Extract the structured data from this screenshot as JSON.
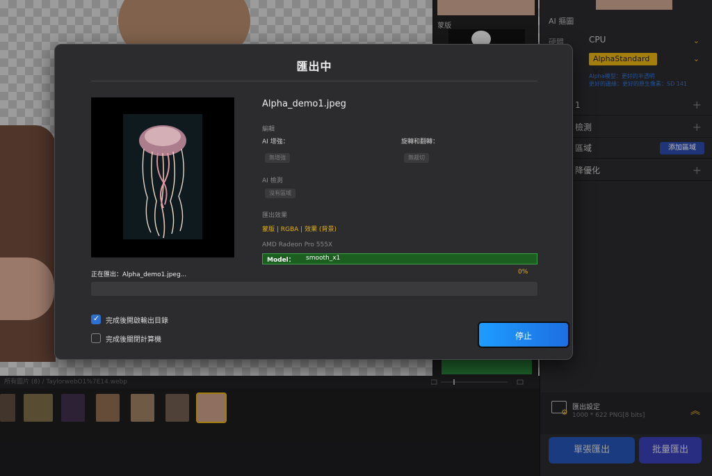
{
  "modal": {
    "title": "匯出中",
    "file_name": "Alpha_demo1.jpeg",
    "edit_section": "編輯",
    "ai_enhance_label": "AI 增強：",
    "ai_enhance_value": "無增強",
    "rotate_label": "旋轉和翻轉：",
    "rotate_value": "無裁切",
    "ai_detect_section": "AI 檢測",
    "ai_detect_value": "沒有區域",
    "export_effect_section": "匯出效果",
    "export_effect_value": "蒙版 | RGBA | 效果 (背景)",
    "gpu_name": "AMD Radeon Pro 555X",
    "model_label": "Model：",
    "model_value": "smooth_x1",
    "progress_percent_text": "0%",
    "progress_fraction": 0,
    "exporting_text": "正在匯出：Alpha_demo1.jpeg...",
    "open_dir_label": "完成後開啟輸出目錄",
    "open_dir_checked": true,
    "shutdown_label": "完成後關閉計算機",
    "shutdown_checked": false,
    "stop_button": "停止"
  },
  "right_panel": {
    "ai_header": "AI 摳圖",
    "hardware_label": "硬體",
    "hardware_value": "CPU",
    "model_value": "AlphaStandard V2",
    "note_line1": "Alpha模型：更好的半透明",
    "note_line2": "更好的邊緣：更好的原生像素：SD 141",
    "row1_label": "1",
    "row2_label": "檢測",
    "row3_label": "區域",
    "add_area_button": "添加區域",
    "row4_label": "降優化",
    "export_settings_title": "匯出設定",
    "export_settings_info": "1000 * 622 PNG[8 bits]",
    "single_export": "單張匯出",
    "batch_export": "批量匯出"
  },
  "layer_column": {
    "mask_label": "蒙版"
  },
  "file_bar": {
    "text": "所有圖片 (8) / TaylorwebO1%7E14.webp"
  },
  "colors": {
    "accent_yellow": "#e3b014",
    "accent_blue": "#1e9cff",
    "model_green": "#1b5e20"
  }
}
